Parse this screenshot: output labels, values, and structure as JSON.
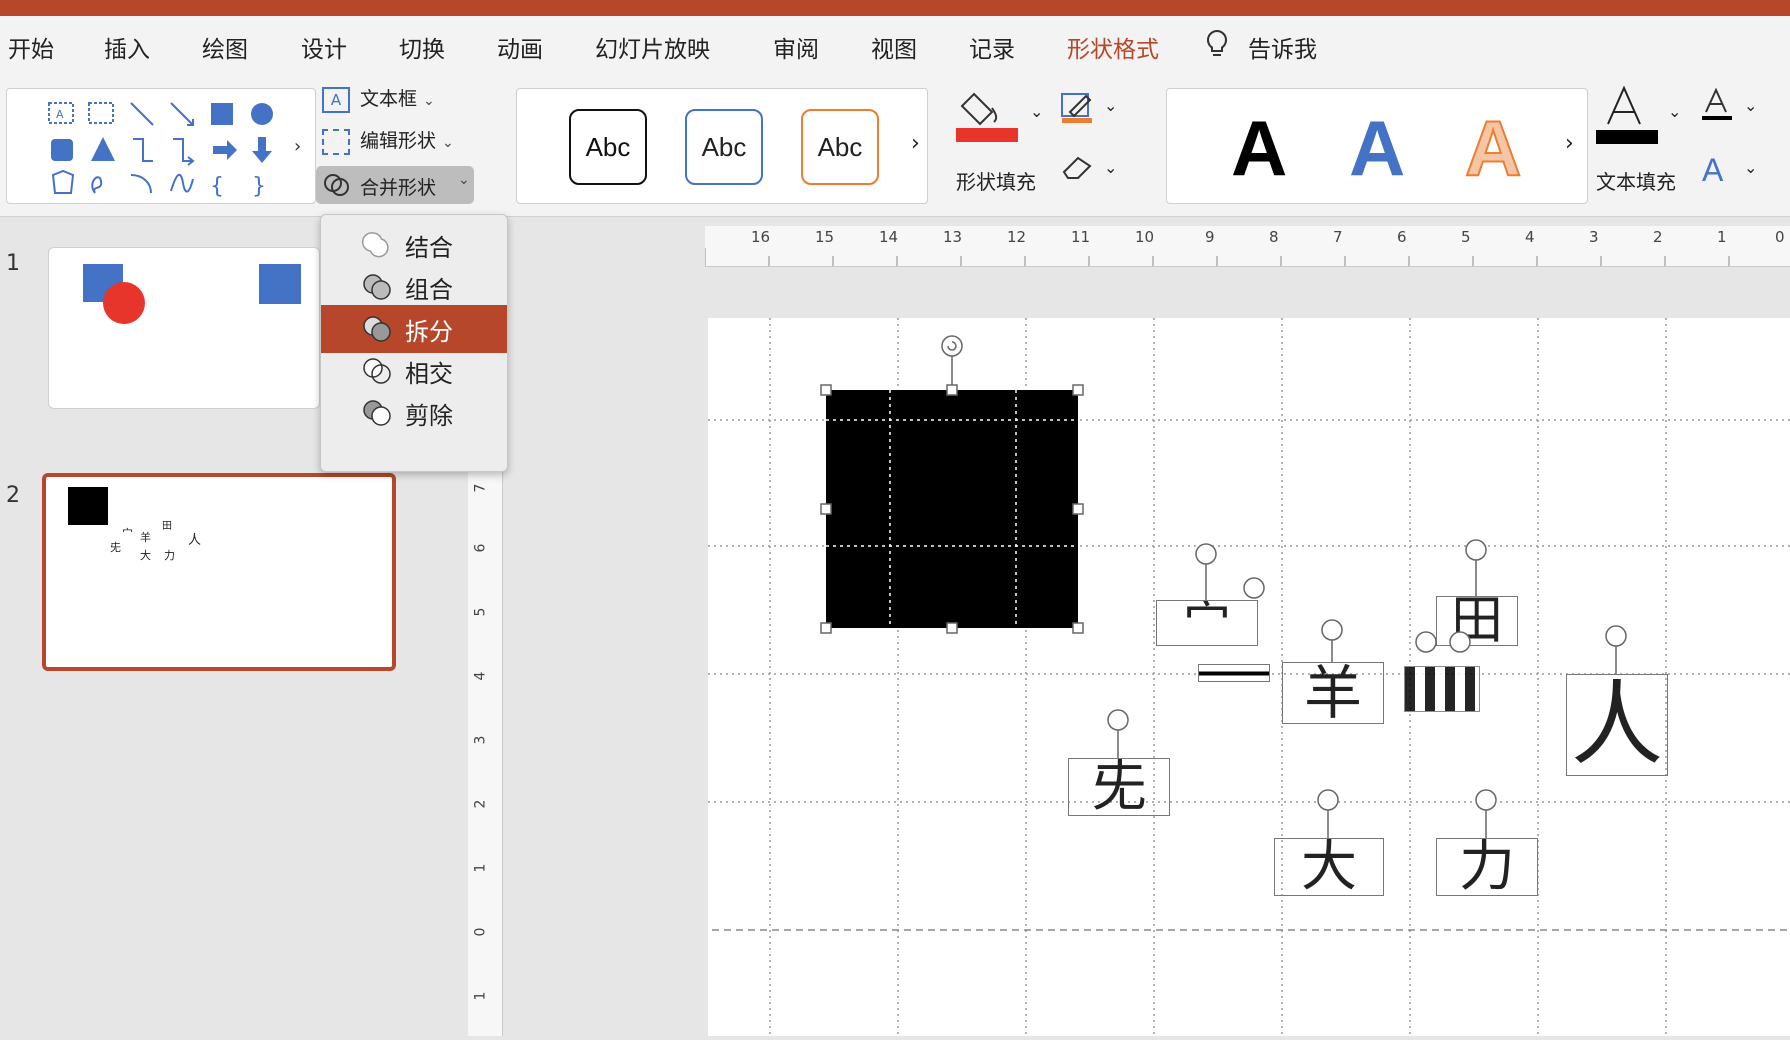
{
  "tabs": [
    "开始",
    "插入",
    "绘图",
    "设计",
    "切换",
    "动画",
    "幻灯片放映",
    "审阅",
    "视图",
    "记录",
    "形状格式",
    "告诉我"
  ],
  "active_tab": "形状格式",
  "ribbon": {
    "text_box_label": "文本框",
    "edit_shape_label": "编辑形状",
    "merge_shapes_label": "合并形状",
    "shape_style_samples": [
      "Abc",
      "Abc",
      "Abc"
    ],
    "shape_fill_label": "形状填充",
    "wordart_samples": [
      "A",
      "A",
      "A"
    ],
    "text_fill_label": "文本填充",
    "colors": {
      "fill_red": "#e8352b",
      "accent": "#b7472a",
      "blue": "#4472c4",
      "orange": "#ed7d31"
    }
  },
  "merge_menu": {
    "items": [
      "结合",
      "组合",
      "拆分",
      "相交",
      "剪除"
    ],
    "highlighted": "拆分"
  },
  "slides": {
    "numbers": [
      "1",
      "2"
    ],
    "selected": "2",
    "slide2_thumb_glyphs": [
      "宀",
      "兂",
      "羊",
      "田",
      "人",
      "大",
      "力"
    ]
  },
  "ruler_top_labels": [
    "16",
    "15",
    "14",
    "13",
    "12",
    "11",
    "10",
    "9",
    "8",
    "7",
    "6",
    "5",
    "4",
    "3",
    "2",
    "1",
    "0"
  ],
  "ruler_left_labels": [
    "7",
    "6",
    "5",
    "4",
    "3",
    "2",
    "1",
    "0",
    "1"
  ],
  "canvas_glyphs": [
    "宀",
    "兂",
    "羊",
    "田",
    "人",
    "大",
    "力"
  ]
}
